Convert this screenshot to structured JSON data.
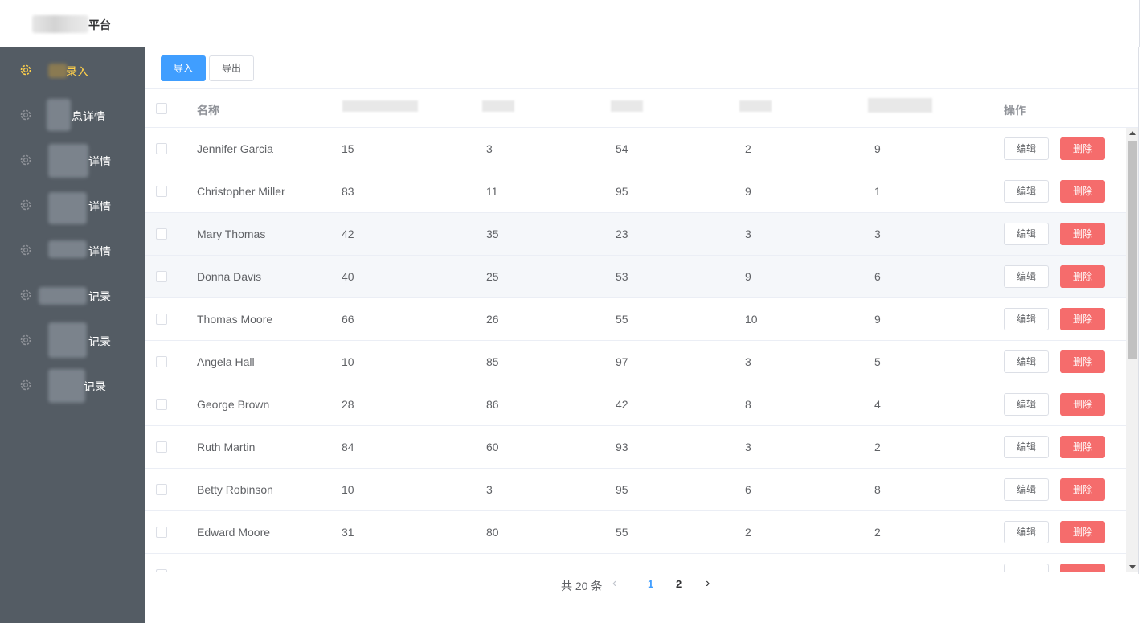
{
  "header": {
    "title": "平台"
  },
  "sidebar": {
    "items": [
      {
        "label": "录入",
        "active": true
      },
      {
        "label": "息详情"
      },
      {
        "label": "详情"
      },
      {
        "label": "详情"
      },
      {
        "label": "详情"
      },
      {
        "label": "记录"
      },
      {
        "label": "记录"
      },
      {
        "label": "记录"
      }
    ]
  },
  "toolbar": {
    "import_label": "导入",
    "export_label": "导出"
  },
  "table": {
    "columns": [
      "名称",
      "",
      "",
      "",
      "",
      "操作"
    ],
    "rows": [
      {
        "name": "Jennifer Garcia",
        "c1": "15",
        "c2": "3",
        "c3": "54",
        "c4": "2",
        "c5": "9"
      },
      {
        "name": "Christopher Miller",
        "c1": "83",
        "c2": "11",
        "c3": "95",
        "c4": "9",
        "c5": "1"
      },
      {
        "name": "Mary Thomas",
        "c1": "42",
        "c2": "35",
        "c3": "23",
        "c4": "3",
        "c5": "3"
      },
      {
        "name": "Donna Davis",
        "c1": "40",
        "c2": "25",
        "c3": "53",
        "c4": "9",
        "c5": "6"
      },
      {
        "name": "Thomas Moore",
        "c1": "66",
        "c2": "26",
        "c3": "55",
        "c4": "10",
        "c5": "9"
      },
      {
        "name": "Angela Hall",
        "c1": "10",
        "c2": "85",
        "c3": "97",
        "c4": "3",
        "c5": "5"
      },
      {
        "name": "George Brown",
        "c1": "28",
        "c2": "86",
        "c3": "42",
        "c4": "8",
        "c5": "4"
      },
      {
        "name": "Ruth Martin",
        "c1": "84",
        "c2": "60",
        "c3": "93",
        "c4": "3",
        "c5": "2"
      },
      {
        "name": "Betty Robinson",
        "c1": "10",
        "c2": "3",
        "c3": "95",
        "c4": "6",
        "c5": "8"
      },
      {
        "name": "Edward Moore",
        "c1": "31",
        "c2": "80",
        "c3": "55",
        "c4": "2",
        "c5": "2"
      },
      {
        "name": "",
        "c1": "",
        "c2": "",
        "c3": "",
        "c4": "",
        "c5": ""
      }
    ],
    "edit_label": "编辑",
    "delete_label": "删除"
  },
  "pagination": {
    "total_text": "共 20 条",
    "pages": [
      "1",
      "2"
    ],
    "current_page": "1"
  },
  "colors": {
    "sidebar_bg": "#545c64",
    "active_menu": "#ffd04b",
    "primary": "#409eff",
    "danger": "#f56c6c"
  }
}
